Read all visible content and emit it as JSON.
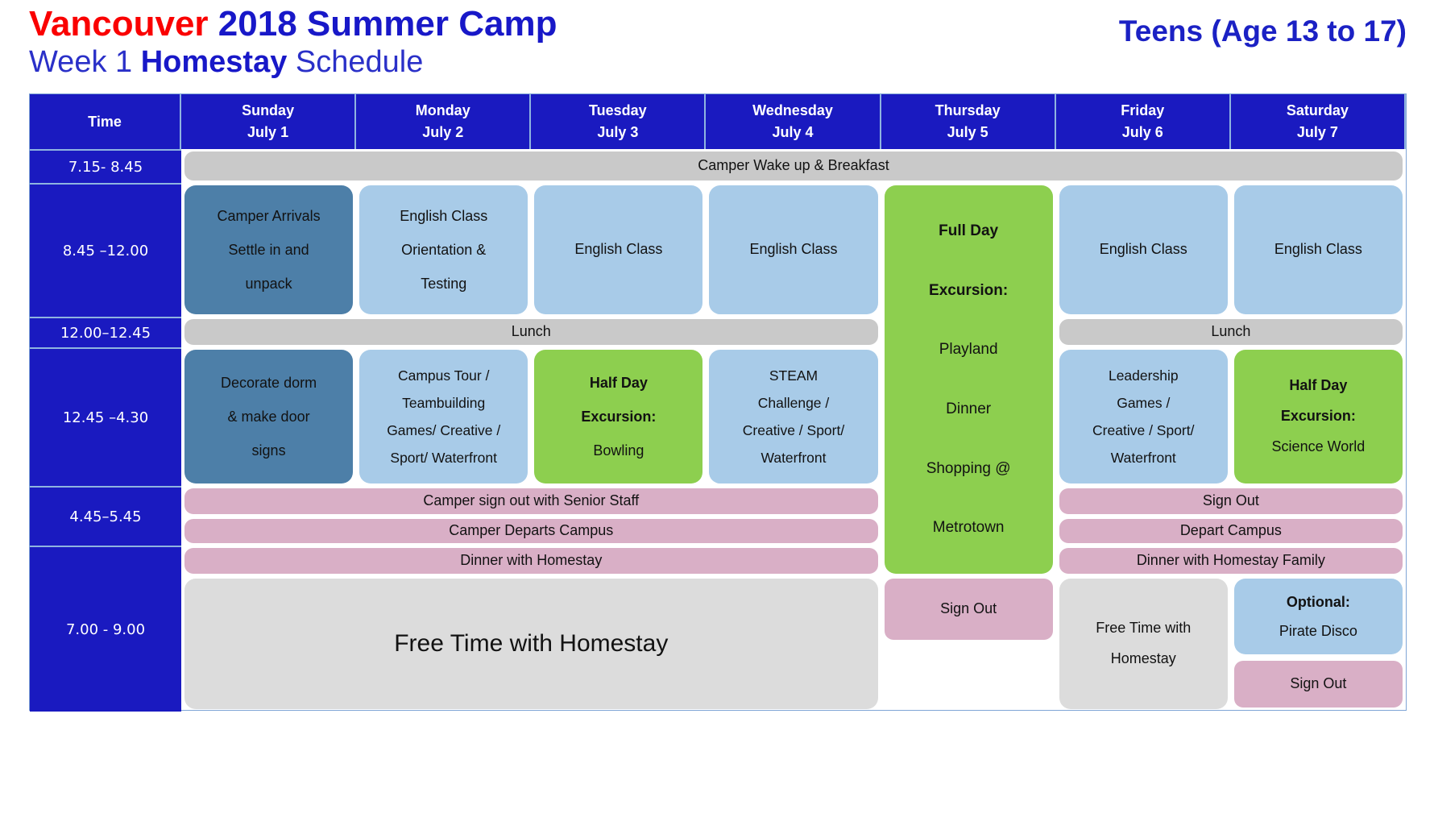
{
  "header": {
    "title_part1": "Vancouver",
    "title_part2": "2018 Summer Camp",
    "subtitle_part1": "Week 1",
    "subtitle_part2": "Homestay",
    "subtitle_part3": "Schedule",
    "audience": "Teens (Age 13 to 17)",
    "colors": {
      "red": "#fa0000",
      "blue": "#1818c8"
    }
  },
  "table": {
    "columns": [
      {
        "day": "Time",
        "date": ""
      },
      {
        "day": "Sunday",
        "date": "July 1"
      },
      {
        "day": "Monday",
        "date": "July 2"
      },
      {
        "day": "Tuesday",
        "date": "July 3"
      },
      {
        "day": "Wednesday",
        "date": "July 4"
      },
      {
        "day": "Thursday",
        "date": "July 5"
      },
      {
        "day": "Friday",
        "date": "July 6"
      },
      {
        "day": "Saturday",
        "date": "July 7"
      }
    ],
    "times": [
      "7.15- 8.45",
      "8.45 –12.00",
      "12.00–12.45",
      "12.45 –4.30",
      "4.45–5.45",
      "7.00 - 9.00"
    ],
    "breakfast_band": "Camper Wake up & Breakfast",
    "morning": {
      "sunday_l1": "Camper Arrivals",
      "sunday_l2": "Settle in and",
      "sunday_l3": "unpack",
      "monday_l1": "English Class",
      "monday_l2": "Orientation &",
      "monday_l3": "Testing",
      "tuesday": "English Class",
      "wednesday": "English Class",
      "friday": "English Class",
      "saturday": "English Class"
    },
    "thursday": {
      "l1": "Full Day",
      "l2": "Excursion:",
      "l3": "Playland",
      "l4": "Dinner",
      "l5": "Shopping @",
      "l6": "Metrotown",
      "signout": "Sign Out"
    },
    "lunch_left": "Lunch",
    "lunch_right": "Lunch",
    "afternoon": {
      "sunday_l1": "Decorate dorm",
      "sunday_l2": "& make door",
      "sunday_l3": "signs",
      "monday_l1": "Campus Tour /",
      "monday_l2": "Teambuilding",
      "monday_l3": "Games/ Creative /",
      "monday_l4": "Sport/ Waterfront",
      "tuesday_l1": "Half Day",
      "tuesday_l2": "Excursion:",
      "tuesday_l3": "Bowling",
      "wednesday_l1": "STEAM",
      "wednesday_l2": "Challenge /",
      "wednesday_l3": "Creative / Sport/",
      "wednesday_l4": "Waterfront",
      "friday_l1": "Leadership",
      "friday_l2": "Games /",
      "friday_l3": "Creative / Sport/",
      "friday_l4": "Waterfront",
      "saturday_l1": "Half Day",
      "saturday_l2": "Excursion:",
      "saturday_l3": "Science World"
    },
    "evening": {
      "signout_left": "Camper sign out with Senior Staff",
      "depart_left": "Camper Departs Campus",
      "dinner_left": "Dinner with Homestay",
      "signout_right": "Sign Out",
      "depart_right": "Depart Campus",
      "dinner_right": "Dinner with Homestay Family",
      "free_time_left": "Free Time with Homestay",
      "free_time_friday_l1": "Free Time with",
      "free_time_friday_l2": "Homestay",
      "optional_label": "Optional:",
      "optional_value": "Pirate Disco",
      "saturday_signout": "Sign Out"
    }
  },
  "colors": {
    "header_blue": "#1a1ac0",
    "light_blue": "#a8cbe8",
    "dark_blue": "#4d7fa8",
    "green": "#8dcf4f",
    "pink": "#d9afc6",
    "grey": "#c9c9c9",
    "light_grey": "#dcdcdc"
  }
}
